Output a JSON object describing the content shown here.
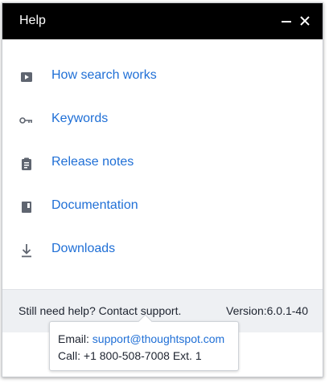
{
  "header": {
    "title": "Help"
  },
  "links": [
    {
      "icon": "play-video-icon",
      "label": "How search works"
    },
    {
      "icon": "key-icon",
      "label": "Keywords"
    },
    {
      "icon": "clipboard-icon",
      "label": "Release notes"
    },
    {
      "icon": "book-icon",
      "label": "Documentation"
    },
    {
      "icon": "download-icon",
      "label": "Downloads"
    }
  ],
  "footer": {
    "help_text": "Still need help? Contact support.",
    "version": "Version:6.0.1-40"
  },
  "tooltip": {
    "email_label": "Email: ",
    "email": "support@thoughtspot.com",
    "call": "Call: +1 800-508-7008 Ext. 1"
  },
  "colors": {
    "header_bg": "#000000",
    "link": "#1f6fd6",
    "footer_bg": "#eef0f3"
  }
}
